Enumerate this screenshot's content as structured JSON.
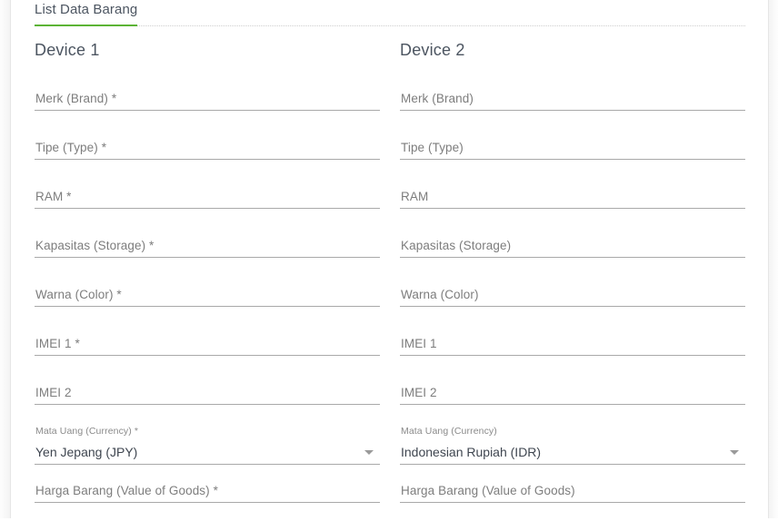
{
  "tabs": [
    {
      "label": "List Data Barang",
      "active": true,
      "accent": "#5cb335"
    }
  ],
  "colors": {
    "tab_active_underline": "#5cb335",
    "heading": "#4c5561",
    "label": "#7d7d7d",
    "value": "#3f4650",
    "field_underline": "#a9a9a9",
    "page_background": "#ffffff"
  },
  "columns": [
    {
      "title": "Device 1",
      "fields": [
        {
          "label": "Merk (Brand) *",
          "type": "text",
          "value": ""
        },
        {
          "label": "Tipe (Type) *",
          "type": "text",
          "value": ""
        },
        {
          "label": "RAM *",
          "type": "text",
          "value": ""
        },
        {
          "label": "Kapasitas (Storage) *",
          "type": "text",
          "value": ""
        },
        {
          "label": "Warna (Color) *",
          "type": "text",
          "value": ""
        },
        {
          "label": "IMEI 1 *",
          "type": "text",
          "value": ""
        },
        {
          "label": "IMEI 2",
          "type": "text",
          "value": ""
        },
        {
          "label": "Mata Uang (Currency) *",
          "type": "select",
          "value": "Yen Jepang (JPY)"
        },
        {
          "label": "Harga Barang (Value of Goods) *",
          "type": "text",
          "value": ""
        }
      ]
    },
    {
      "title": "Device 2",
      "fields": [
        {
          "label": "Merk (Brand)",
          "type": "text",
          "value": ""
        },
        {
          "label": "Tipe (Type)",
          "type": "text",
          "value": ""
        },
        {
          "label": "RAM",
          "type": "text",
          "value": ""
        },
        {
          "label": "Kapasitas (Storage)",
          "type": "text",
          "value": ""
        },
        {
          "label": "Warna (Color)",
          "type": "text",
          "value": ""
        },
        {
          "label": "IMEI 1",
          "type": "text",
          "value": ""
        },
        {
          "label": "IMEI 2",
          "type": "text",
          "value": ""
        },
        {
          "label": "Mata Uang (Currency)",
          "type": "select",
          "value": "Indonesian Rupiah (IDR)"
        },
        {
          "label": "Harga Barang (Value of Goods)",
          "type": "text",
          "value": ""
        }
      ]
    }
  ],
  "icons": {
    "dropdown": "chevron-down-icon"
  }
}
